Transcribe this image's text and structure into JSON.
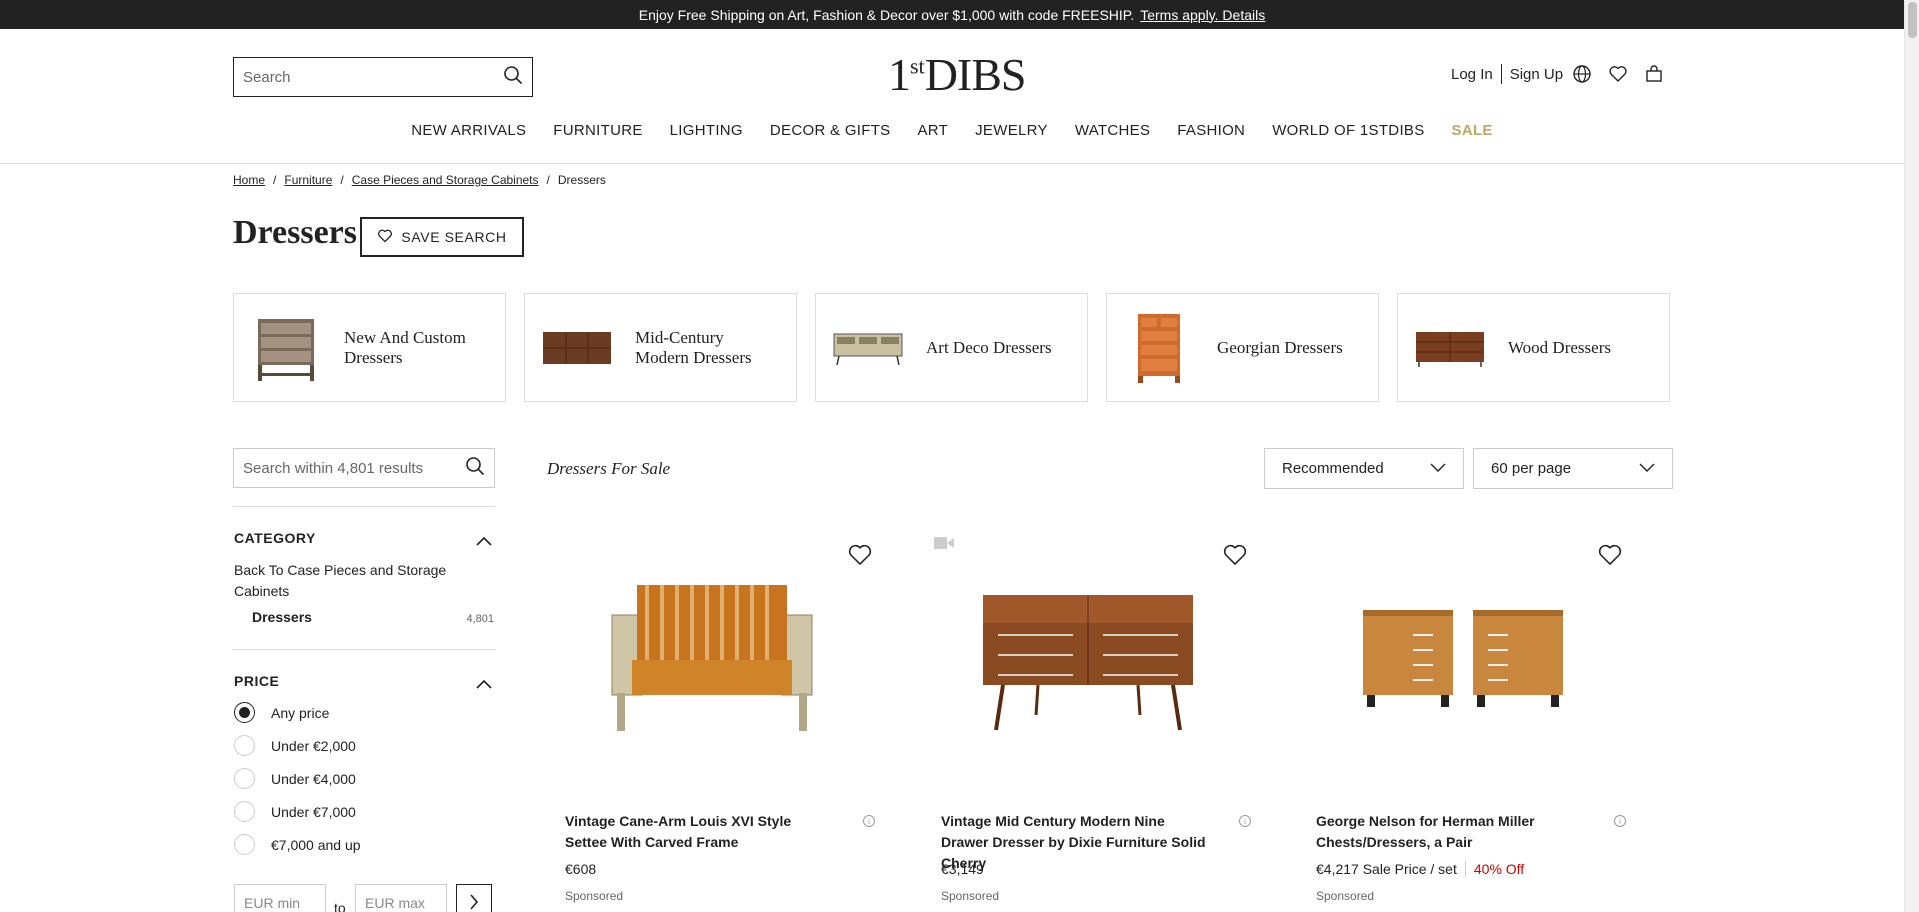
{
  "promo": {
    "text": "Enjoy Free Shipping on Art, Fashion & Decor over $1,000 with code FREESHIP.",
    "link": "Terms apply. Details"
  },
  "header": {
    "search_placeholder": "Search",
    "logo_main": "1",
    "logo_sup": "st",
    "logo_rest": "DIBS",
    "login": "Log In",
    "signup": "Sign Up"
  },
  "nav": {
    "items": [
      "NEW ARRIVALS",
      "FURNITURE",
      "LIGHTING",
      "DECOR & GIFTS",
      "ART",
      "JEWELRY",
      "WATCHES",
      "FASHION",
      "WORLD OF 1STDIBS"
    ],
    "sale": "SALE"
  },
  "breadcrumb": {
    "home": "Home",
    "furniture": "Furniture",
    "case": "Case Pieces and Storage Cabinets",
    "current": "Dressers",
    "separator": "/"
  },
  "page": {
    "title": "Dressers",
    "save_search": "SAVE SEARCH",
    "results_title": "Dressers For Sale"
  },
  "tiles": [
    {
      "label": "New And Custom Dressers"
    },
    {
      "label": "Mid-Century Modern Dressers"
    },
    {
      "label": "Art Deco Dressers"
    },
    {
      "label": "Georgian Dressers"
    },
    {
      "label": "Wood Dressers"
    }
  ],
  "sidebar": {
    "search_placeholder": "Search within 4,801 results",
    "category_heading": "CATEGORY",
    "back_link": "Back To Case Pieces and Storage Cabinets",
    "category_name": "Dressers",
    "category_count": "4,801",
    "price_heading": "PRICE",
    "price_options": [
      "Any price",
      "Under €2,000",
      "Under €4,000",
      "Under €7,000",
      "€7,000 and up"
    ],
    "selected_price_index": 0,
    "min_placeholder": "EUR min",
    "to_label": "to",
    "max_placeholder": "EUR max"
  },
  "sort": {
    "selected": "Recommended",
    "per_page": "60 per page"
  },
  "products": [
    {
      "title": "Vintage Cane-Arm Louis XVI Style Settee With Carved Frame",
      "price": "€608",
      "discount": "",
      "sponsored": "Sponsored"
    },
    {
      "title": "Vintage Mid Century Modern Nine Drawer Dresser by Dixie Furniture Solid Cherry",
      "price": "€3,149",
      "discount": "",
      "sponsored": "Sponsored"
    },
    {
      "title": "George Nelson for Herman Miller Chests/Dressers, a Pair",
      "price": "€4,217 Sale Price / set",
      "discount": "40% Off",
      "sponsored": "Sponsored"
    }
  ],
  "colors": {
    "sale_accent": "#c2a661",
    "discount_red": "#cc0000",
    "banner_bg": "#222222"
  }
}
